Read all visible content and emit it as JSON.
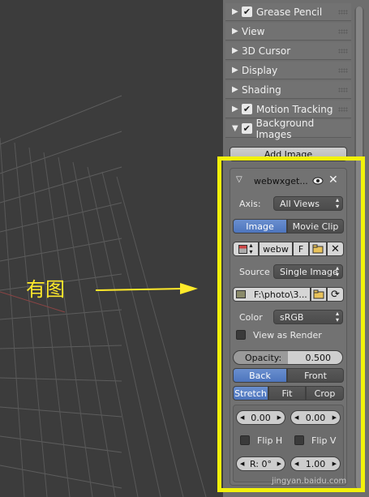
{
  "annotation": {
    "text": "有图"
  },
  "panels": [
    {
      "label": "Grease Pencil",
      "checkbox": true
    },
    {
      "label": "View",
      "checkbox": false
    },
    {
      "label": "3D Cursor",
      "checkbox": false
    },
    {
      "label": "Display",
      "checkbox": false
    },
    {
      "label": "Shading",
      "checkbox": false
    },
    {
      "label": "Motion Tracking",
      "checkbox": true
    },
    {
      "label": "Background Images",
      "checkbox": true,
      "expanded": true
    }
  ],
  "bg": {
    "add_image": "Add Image",
    "item_name": "webwxget...",
    "axis_label": "Axis:",
    "axis_value": "All Views",
    "tab_image": "Image",
    "tab_movieclip": "Movie Clip",
    "image_name": "webw",
    "fake_user": "F",
    "source_label": "Source",
    "source_value": "Single Image",
    "filepath": "F:\\photo\\3...",
    "color_label": "Color",
    "color_value": "sRGB",
    "view_as_render": "View as Render",
    "opacity_label": "Opacity:",
    "opacity_value": "0.500",
    "back": "Back",
    "front": "Front",
    "stretch": "Stretch",
    "fit": "Fit",
    "crop": "Crop",
    "offset_x": "0.00",
    "offset_y": "0.00",
    "flip_h": "Flip H",
    "flip_v": "Flip V",
    "rotation": "R: 0°",
    "size": "1.00"
  },
  "colors": {
    "highlight": "#f2f20a",
    "annotation": "#ffea2a",
    "accent": "#5680c2"
  },
  "watermark": "jingyan.baidu.com"
}
